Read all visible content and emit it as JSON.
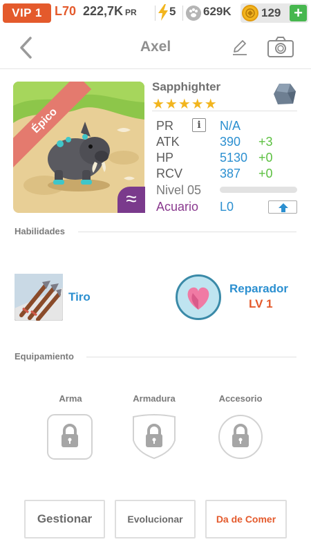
{
  "statusbar": {
    "vip": "VIP 1",
    "level": "L70",
    "power": "222,7K",
    "power_suffix": "PR",
    "energy": "5",
    "paws": "629K",
    "coins": "129",
    "add": "+"
  },
  "header": {
    "title": "Axel"
  },
  "pet": {
    "rarity": "Épico",
    "name": "Sapphighter",
    "stars": "★★★★★",
    "type_symbol": "≈",
    "stats": {
      "pr_label": "PR",
      "pr_value": "N/A",
      "info_glyph": "i",
      "atk_label": "ATK",
      "atk_value": "390",
      "atk_bonus": "+3",
      "hp_label": "HP",
      "hp_value": "5130",
      "hp_bonus": "+0",
      "rcv_label": "RCV",
      "rcv_value": "387",
      "rcv_bonus": "+0",
      "level_label": "Nivel 05",
      "level_progress": 0,
      "aquarium_label": "Acuario",
      "aquarium_value": "L0"
    }
  },
  "abilities": {
    "section": "Habilidades",
    "skill1": {
      "name": "Tiro"
    },
    "skill2": {
      "name": "Reparador",
      "level": "LV 1"
    }
  },
  "equipment": {
    "section": "Equipamiento",
    "slots": [
      "Arma",
      "Armadura",
      "Accesorio"
    ]
  },
  "actions": {
    "manage": "Gestionar",
    "evolve": "Evolucionar",
    "feed": "Da de Comer"
  },
  "colors": {
    "accent_orange": "#e45a2c",
    "value_blue": "#2b8fd0",
    "bonus_green": "#5cc041",
    "aquarium_purple": "#8a3a8f"
  }
}
